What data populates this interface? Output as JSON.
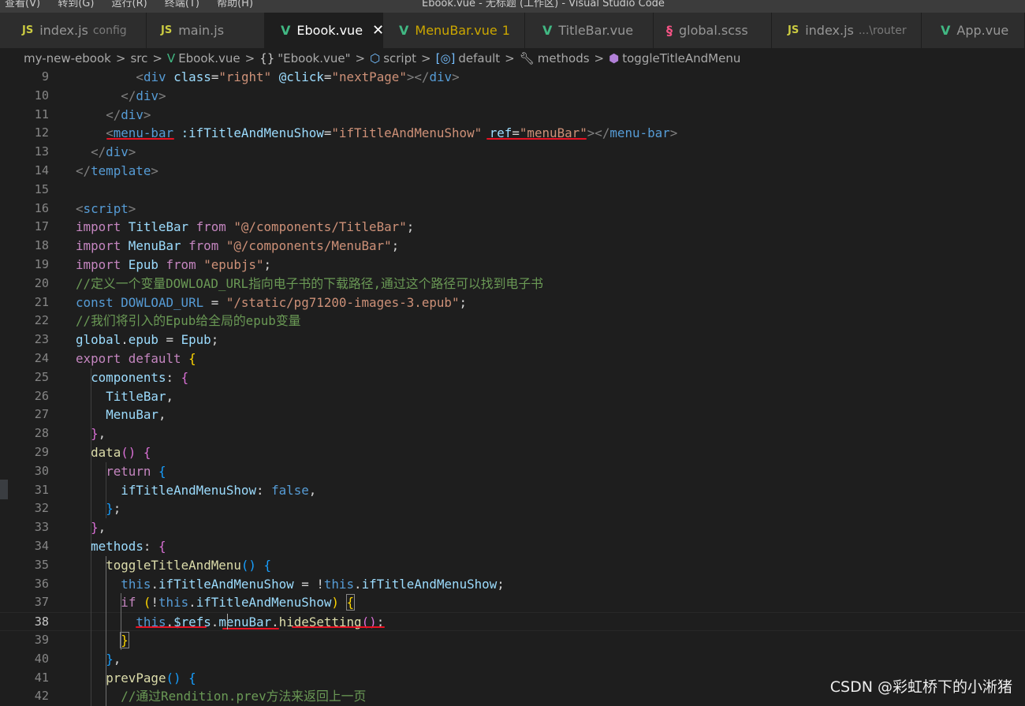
{
  "app": {
    "menu_items": [
      "查看(V)",
      "转到(G)",
      "运行(R)",
      "终端(T)",
      "帮助(H)"
    ],
    "window_title": "Ebook.vue - 无标题 (工作区) - Visual Studio Code"
  },
  "tabs": [
    {
      "icon": "JS",
      "label": "index.js",
      "sub": "config",
      "active": false
    },
    {
      "icon": "V",
      "label": "main.js",
      "sub": "",
      "active": false
    },
    {
      "icon": "V",
      "label": "Ebook.vue",
      "sub": "",
      "active": true,
      "close": "✕"
    },
    {
      "icon": "V",
      "label": "MenuBar.vue",
      "sub": "",
      "count": "1",
      "modified": true
    },
    {
      "icon": "V",
      "label": "TitleBar.vue",
      "sub": "",
      "active": false
    },
    {
      "icon": "§",
      "label": "global.scss",
      "sub": "",
      "active": false
    },
    {
      "icon": "JS",
      "label": "index.js",
      "sub": "...\\router",
      "active": false
    },
    {
      "icon": "V",
      "label": "App.vue",
      "sub": "",
      "active": false
    }
  ],
  "breadcrumb": [
    "my-new-ebook",
    "src",
    "Ebook.vue",
    "\"Ebook.vue\"",
    "script",
    "default",
    "methods",
    "toggleTitleAndMenu"
  ],
  "editor": {
    "current_line": 38,
    "lines": [
      {
        "n": 9,
        "html": "<div class=\"right\" @click=\"nextPage\"></div>"
      },
      {
        "n": 10,
        "html": "</div>"
      },
      {
        "n": 11,
        "html": "</div>"
      },
      {
        "n": 12,
        "html": "<menu-bar :ifTitleAndMenuShow=\"ifTitleAndMenuShow\" ref=\"menuBar\"></menu-bar>"
      },
      {
        "n": 13,
        "html": "</div>"
      },
      {
        "n": 14,
        "html": "</template>"
      },
      {
        "n": 15,
        "html": ""
      },
      {
        "n": 16,
        "html": "<script>"
      },
      {
        "n": 17,
        "html": "import TitleBar from \"@/components/TitleBar\";"
      },
      {
        "n": 18,
        "html": "import MenuBar from \"@/components/MenuBar\";"
      },
      {
        "n": 19,
        "html": "import Epub from \"epubjs\";"
      },
      {
        "n": 20,
        "html": "//定义一个变量DOWLOAD_URL指向电子书的下载路径,通过这个路径可以找到电子书"
      },
      {
        "n": 21,
        "html": "const DOWLOAD_URL = \"/static/pg71200-images-3.epub\";"
      },
      {
        "n": 22,
        "html": "//我们将引入的Epub给全局的epub变量"
      },
      {
        "n": 23,
        "html": "global.epub = Epub;"
      },
      {
        "n": 24,
        "html": "export default {"
      },
      {
        "n": 25,
        "html": "components: {"
      },
      {
        "n": 26,
        "html": "TitleBar,"
      },
      {
        "n": 27,
        "html": "MenuBar,"
      },
      {
        "n": 28,
        "html": "},"
      },
      {
        "n": 29,
        "html": "data() {"
      },
      {
        "n": 30,
        "html": "return {"
      },
      {
        "n": 31,
        "html": "ifTitleAndMenuShow: false,"
      },
      {
        "n": 32,
        "html": "};"
      },
      {
        "n": 33,
        "html": "},"
      },
      {
        "n": 34,
        "html": "methods: {"
      },
      {
        "n": 35,
        "html": "toggleTitleAndMenu() {"
      },
      {
        "n": 36,
        "html": "this.ifTitleAndMenuShow = !this.ifTitleAndMenuShow;"
      },
      {
        "n": 37,
        "html": "if (!this.ifTitleAndMenuShow) {"
      },
      {
        "n": 38,
        "html": "this.$refs.menuBar.hideSetting();"
      },
      {
        "n": 39,
        "html": "}"
      },
      {
        "n": 40,
        "html": "},"
      },
      {
        "n": 41,
        "html": "prevPage() {"
      },
      {
        "n": 42,
        "html": "//通过Rendition.prev方法来返回上一页"
      }
    ]
  },
  "watermark": "CSDN @彩虹桥下的小淅猪",
  "colors": {
    "background": "#1e1e1e",
    "tag": "#569cd6",
    "string": "#ce9178",
    "keyword": "#c586c0",
    "comment": "#6a9955",
    "annotation_red": "#e81123"
  }
}
